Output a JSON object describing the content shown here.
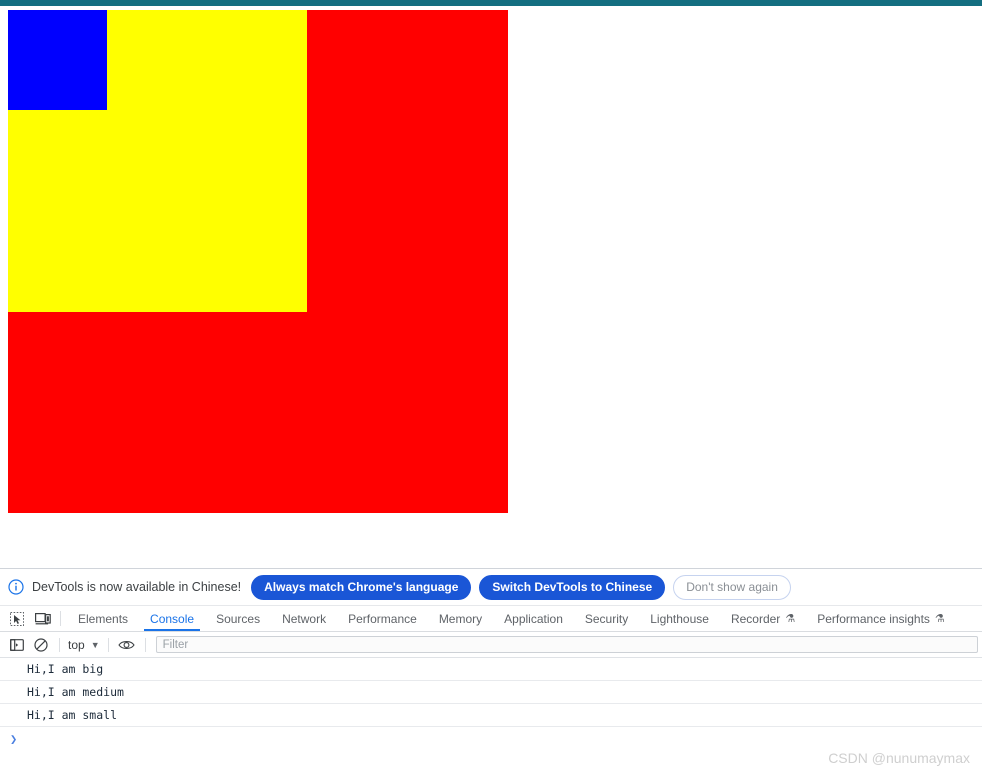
{
  "window": {
    "accent_bar_color": "#146e80"
  },
  "page": {
    "boxes": [
      {
        "name": "big",
        "color": "#ff0000",
        "label": ""
      },
      {
        "name": "medium",
        "color": "#ffff00",
        "label": ""
      },
      {
        "name": "small",
        "color": "#0000ff",
        "label": ""
      }
    ]
  },
  "devtools": {
    "infobar": {
      "icon": "info-circle-icon",
      "message": "DevTools is now available in Chinese!",
      "buttons": [
        {
          "label": "Always match Chrome's language",
          "style": "primary"
        },
        {
          "label": "Switch DevTools to Chinese",
          "style": "primary"
        },
        {
          "label": "Don't show again",
          "style": "ghost"
        }
      ]
    },
    "tabstrip": {
      "icons": [
        {
          "name": "inspect-element-icon"
        },
        {
          "name": "device-toolbar-icon"
        }
      ],
      "tabs": [
        {
          "label": "Elements",
          "active": false,
          "experimental": false
        },
        {
          "label": "Console",
          "active": true,
          "experimental": false
        },
        {
          "label": "Sources",
          "active": false,
          "experimental": false
        },
        {
          "label": "Network",
          "active": false,
          "experimental": false
        },
        {
          "label": "Performance",
          "active": false,
          "experimental": false
        },
        {
          "label": "Memory",
          "active": false,
          "experimental": false
        },
        {
          "label": "Application",
          "active": false,
          "experimental": false
        },
        {
          "label": "Security",
          "active": false,
          "experimental": false
        },
        {
          "label": "Lighthouse",
          "active": false,
          "experimental": false
        },
        {
          "label": "Recorder",
          "active": false,
          "experimental": true
        },
        {
          "label": "Performance insights",
          "active": false,
          "experimental": true
        }
      ],
      "experimental_glyph": "⚗"
    },
    "console_toolbar": {
      "sidebar_toggle_icon": "console-sidebar-icon",
      "clear_icon": "clear-console-icon",
      "context": "top",
      "context_caret": "▼",
      "live_expression_icon": "eye-icon",
      "filter_placeholder": "Filter",
      "filter_value": ""
    },
    "console_output": {
      "messages": [
        "Hi,I am big",
        "Hi,I am medium",
        "Hi,I am small"
      ],
      "prompt_caret": "❯"
    }
  },
  "watermark": {
    "text": "CSDN @nunumaymax"
  }
}
